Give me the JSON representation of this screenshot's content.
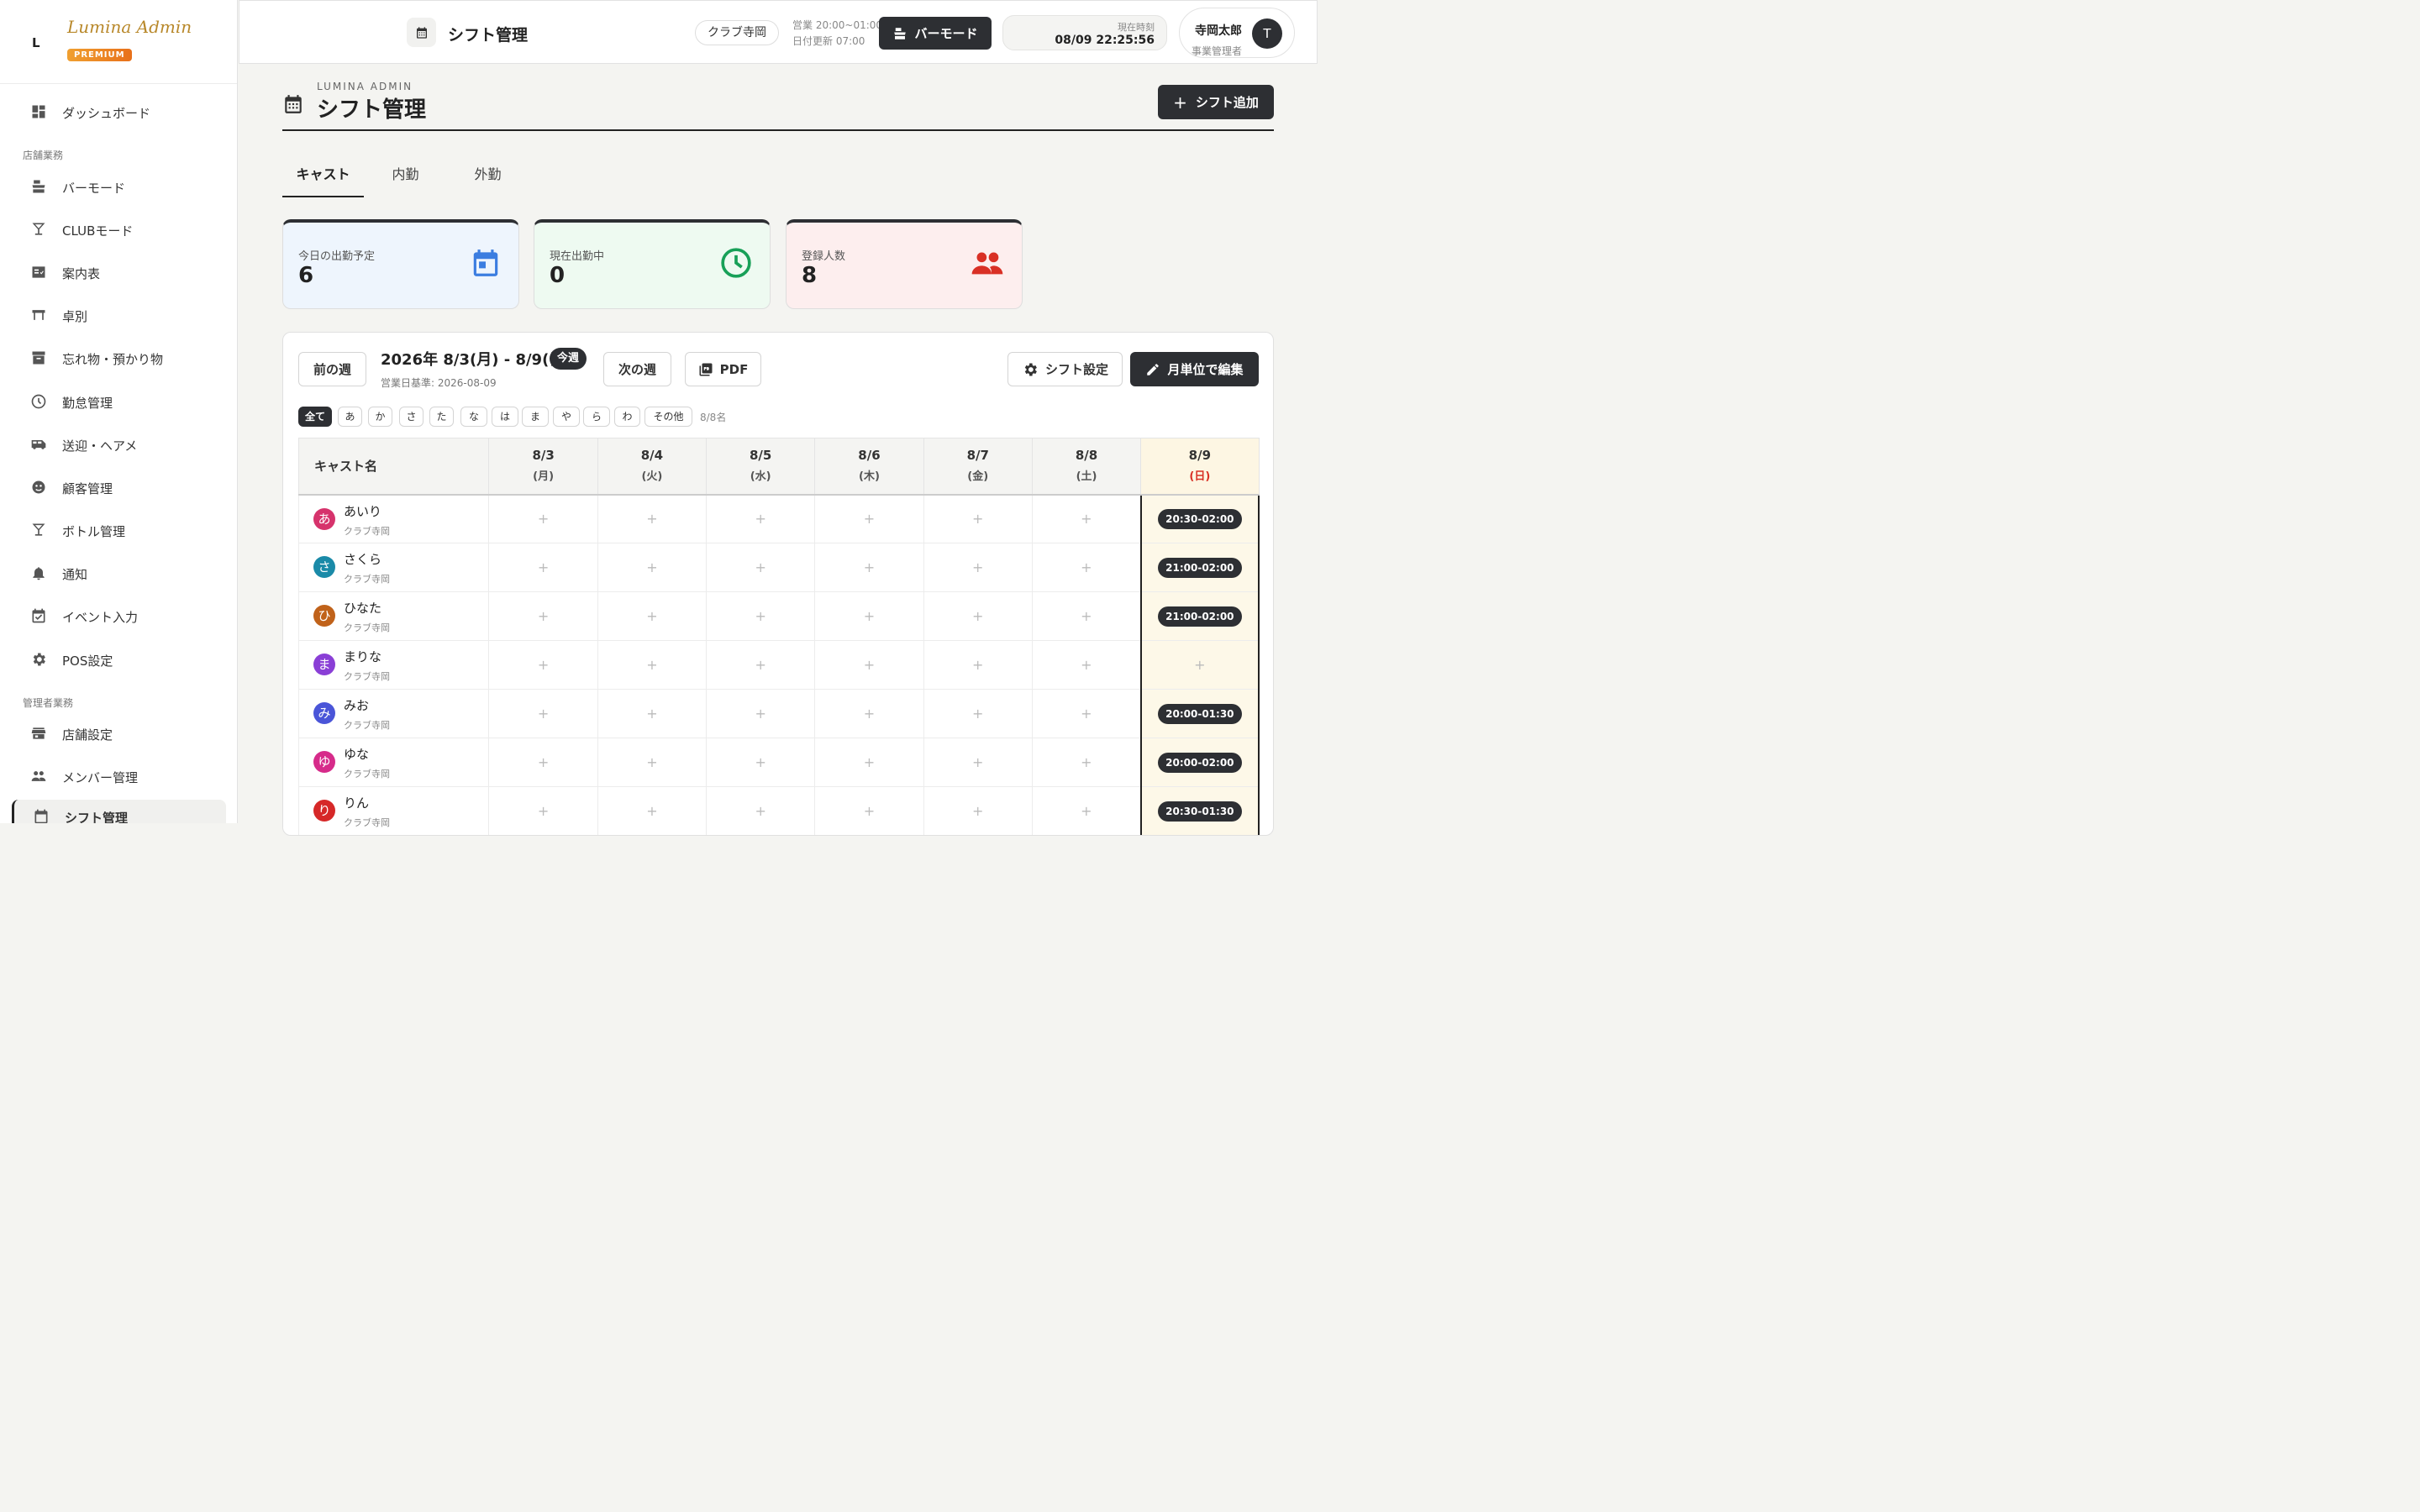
{
  "brand": {
    "logo_mark": "L",
    "logo_text": "Lumina Admin",
    "badge": "PREMIUM"
  },
  "sidebar": {
    "top_item": "ダッシュボード",
    "section_store": "店舗業務",
    "store_items": [
      "バーモード",
      "CLUBモード",
      "案内表",
      "卓別",
      "忘れ物・預かり物",
      "勤怠管理",
      "送迎・ヘアメ",
      "顧客管理",
      "ボトル管理",
      "通知",
      "イベント入力",
      "POS設定"
    ],
    "section_admin": "管理者業務",
    "admin_items": [
      "店舗設定",
      "メンバー管理",
      "シフト管理"
    ]
  },
  "header": {
    "title": "シフト管理",
    "store": "クラブ寺岡",
    "hours": "営業 20:00~01:00",
    "date_update": "日付更新 07:00",
    "bar_mode": "バーモード",
    "clock_caption": "現在時刻",
    "clock_time": "08/09 22:25:56",
    "user_name": "寺岡太郎",
    "user_role": "事業管理者",
    "user_initial": "T"
  },
  "page": {
    "eyebrow": "LUMINA ADMIN",
    "title": "シフト管理",
    "add_button": "シフト追加"
  },
  "tabs": [
    "キャスト",
    "内勤",
    "外勤"
  ],
  "stats": [
    {
      "label": "今日の出勤予定",
      "value": "6",
      "color": "#3b7de0",
      "bg": "#eef5fd"
    },
    {
      "label": "現在出勤中",
      "value": "0",
      "color": "#18a058",
      "bg": "#eefaf1"
    },
    {
      "label": "登録人数",
      "value": "8",
      "color": "#d93025",
      "bg": "#fdeeee"
    }
  ],
  "schedule": {
    "prev_week": "前の週",
    "week_range": "2026年 8/3(月) - 8/9(日)",
    "this_week": "今週",
    "biz_date": "営業日基準: 2026-08-09",
    "next_week": "次の週",
    "pdf": "PDF",
    "shift_settings": "シフト設定",
    "monthly_edit": "月単位で編集",
    "kana_filters": [
      "全て",
      "あ",
      "か",
      "さ",
      "た",
      "な",
      "は",
      "ま",
      "や",
      "ら",
      "わ",
      "その他"
    ],
    "kana_count": "8/8名",
    "name_header": "キャスト名",
    "days": [
      {
        "date": "8/3",
        "dow": "(月)"
      },
      {
        "date": "8/4",
        "dow": "(火)"
      },
      {
        "date": "8/5",
        "dow": "(水)"
      },
      {
        "date": "8/6",
        "dow": "(木)"
      },
      {
        "date": "8/7",
        "dow": "(金)"
      },
      {
        "date": "8/8",
        "dow": "(土)"
      },
      {
        "date": "8/9",
        "dow": "(日)"
      }
    ],
    "empty_mark": "+",
    "casts": [
      {
        "initial": "あ",
        "name": "あいり",
        "store": "クラブ寺岡",
        "color": "#d6336c",
        "today": "20:30-02:00"
      },
      {
        "initial": "さ",
        "name": "さくら",
        "store": "クラブ寺岡",
        "color": "#1a8aa8",
        "today": "21:00-02:00"
      },
      {
        "initial": "ひ",
        "name": "ひなた",
        "store": "クラブ寺岡",
        "color": "#c0621a",
        "today": "21:00-02:00"
      },
      {
        "initial": "ま",
        "name": "まりな",
        "store": "クラブ寺岡",
        "color": "#8a3fd6",
        "today": ""
      },
      {
        "initial": "み",
        "name": "みお",
        "store": "クラブ寺岡",
        "color": "#4a55d8",
        "today": "20:00-01:30"
      },
      {
        "initial": "ゆ",
        "name": "ゆな",
        "store": "クラブ寺岡",
        "color": "#d62b8a",
        "today": "20:00-02:00"
      },
      {
        "initial": "り",
        "name": "りん",
        "store": "クラブ寺岡",
        "color": "#d62828",
        "today": "20:30-01:30"
      }
    ]
  }
}
